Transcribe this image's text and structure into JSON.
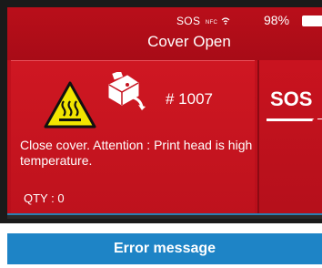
{
  "header": {
    "sos_status": "SOS",
    "nfc_label": "NFC",
    "battery": "98%",
    "title": "Cover Open"
  },
  "panel": {
    "job_number": "# 1007",
    "message": "Close cover. Attention : Print head is high temperature.",
    "qty": "QTY : 0"
  },
  "sos_button": {
    "label": "SOS"
  },
  "caption": "Error message",
  "colors": {
    "screen_red": "#c5121e",
    "warning_yellow": "#f2e500",
    "caption_blue": "#1e84c6"
  },
  "icons": [
    "wifi-icon",
    "battery-icon",
    "hot-surface-warning-icon",
    "printer-icon",
    "back-arrow-icon"
  ]
}
